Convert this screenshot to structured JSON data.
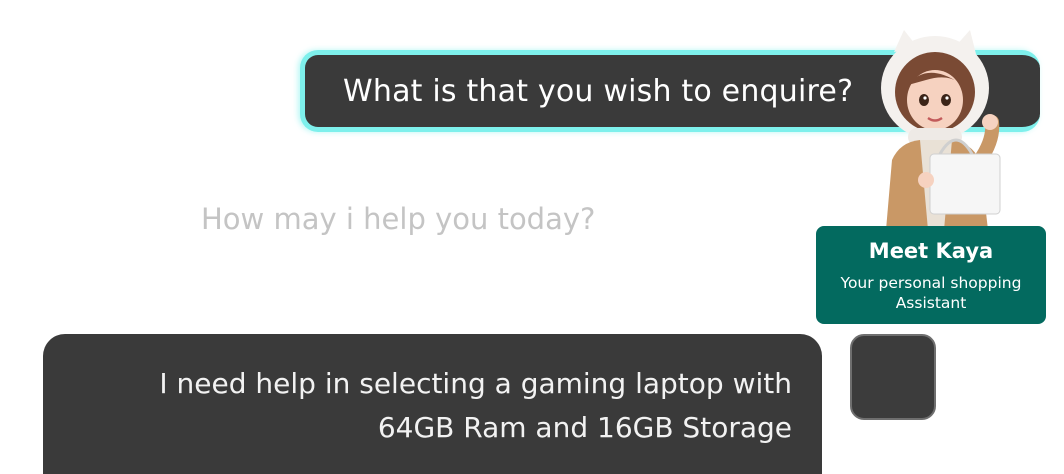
{
  "assistant_message": {
    "text": "What is that you wish to enquire?"
  },
  "prompt_hint": {
    "text": "How may i help you today?"
  },
  "assistant_card": {
    "title": "Meet Kaya",
    "subtitle": "Your personal shopping Assistant",
    "accent_color": "#036a5f"
  },
  "user_message": {
    "text": "I need help in selecting a gaming laptop with 64GB Ram and 16GB Storage"
  },
  "icons": {
    "assistant_avatar": "kaya-avatar-icon",
    "user_avatar": "user-avatar-icon"
  },
  "colors": {
    "bubble_bg": "#3a3a3a",
    "highlight": "#7ef0ec",
    "hint_text": "#c4c4c4"
  }
}
